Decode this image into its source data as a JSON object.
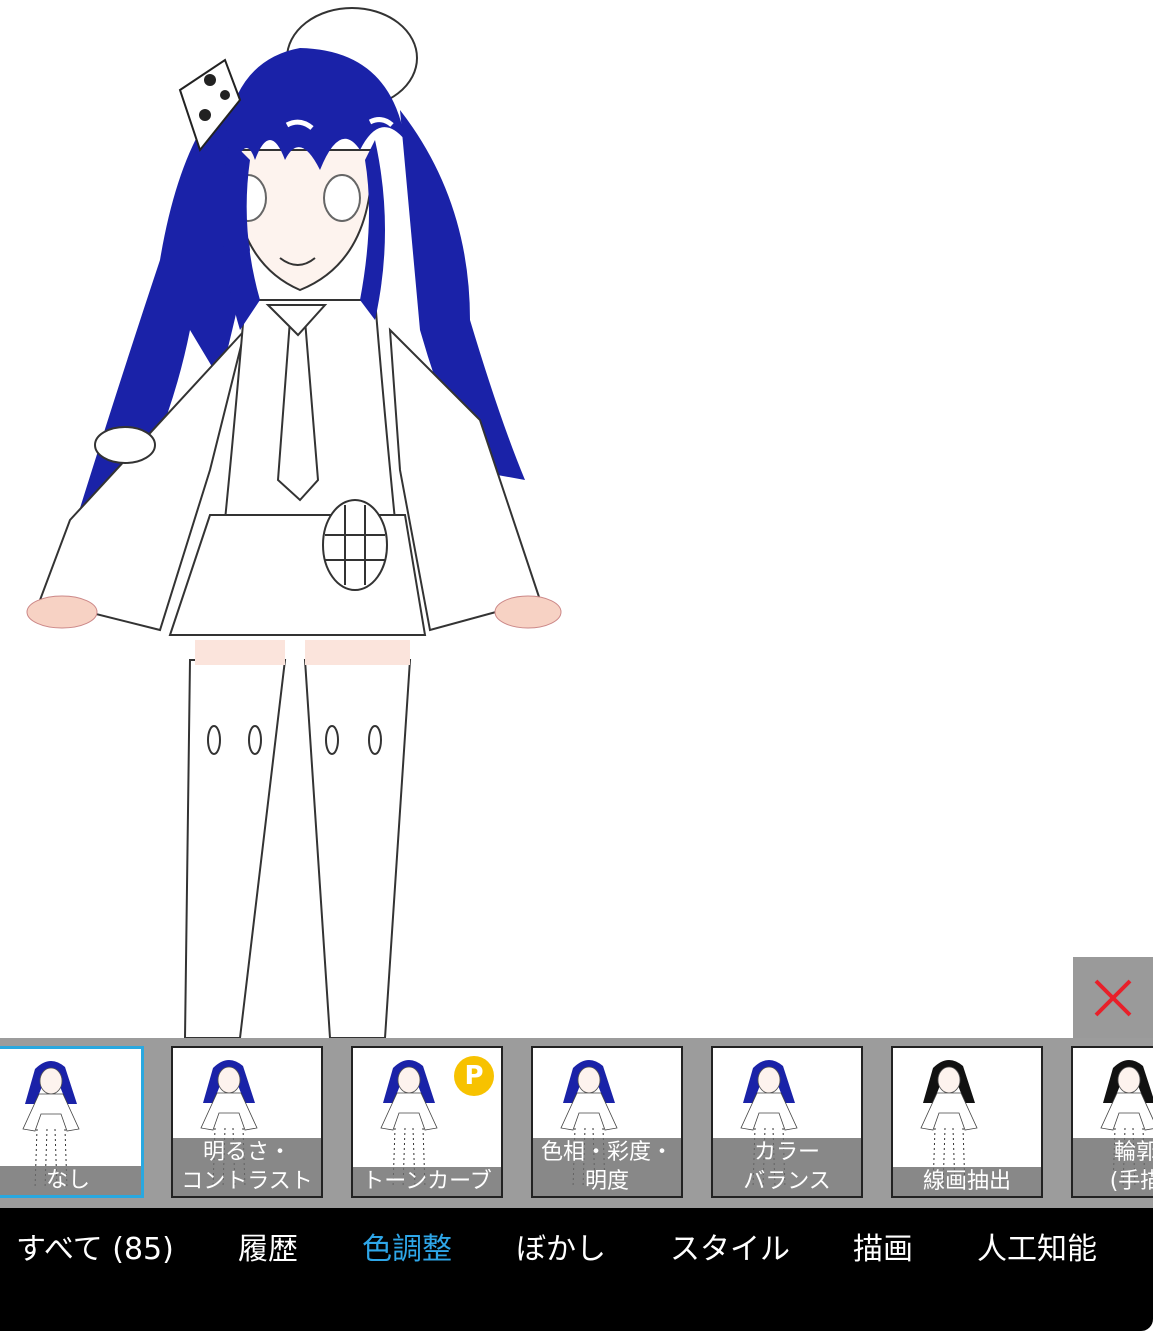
{
  "close_button": {
    "icon": "close-icon",
    "color": "#e8202a"
  },
  "filters": [
    {
      "label_lines": [
        "なし"
      ],
      "selected": true,
      "premium": false
    },
    {
      "label_lines": [
        "明るさ・",
        "コントラスト"
      ],
      "selected": false,
      "premium": false
    },
    {
      "label_lines": [
        "トーンカーブ"
      ],
      "selected": false,
      "premium": true
    },
    {
      "label_lines": [
        "色相・彩度・",
        "明度"
      ],
      "selected": false,
      "premium": false
    },
    {
      "label_lines": [
        "カラー",
        "バランス"
      ],
      "selected": false,
      "premium": false
    },
    {
      "label_lines": [
        "線画抽出"
      ],
      "selected": false,
      "premium": false
    },
    {
      "label_lines": [
        "輪郭線",
        "(手描き"
      ],
      "selected": false,
      "premium": false
    }
  ],
  "premium_badge": "P",
  "tabs": [
    {
      "label": "すべて (85)",
      "active": false
    },
    {
      "label": "履歴",
      "active": false
    },
    {
      "label": "色調整",
      "active": true
    },
    {
      "label": "ぼかし",
      "active": false
    },
    {
      "label": "スタイル",
      "active": false
    },
    {
      "label": "描画",
      "active": false
    },
    {
      "label": "人工知能",
      "active": false
    }
  ],
  "colors": {
    "accent": "#29a8e0",
    "hair": "#1a22a8",
    "badge": "#f7c200"
  }
}
